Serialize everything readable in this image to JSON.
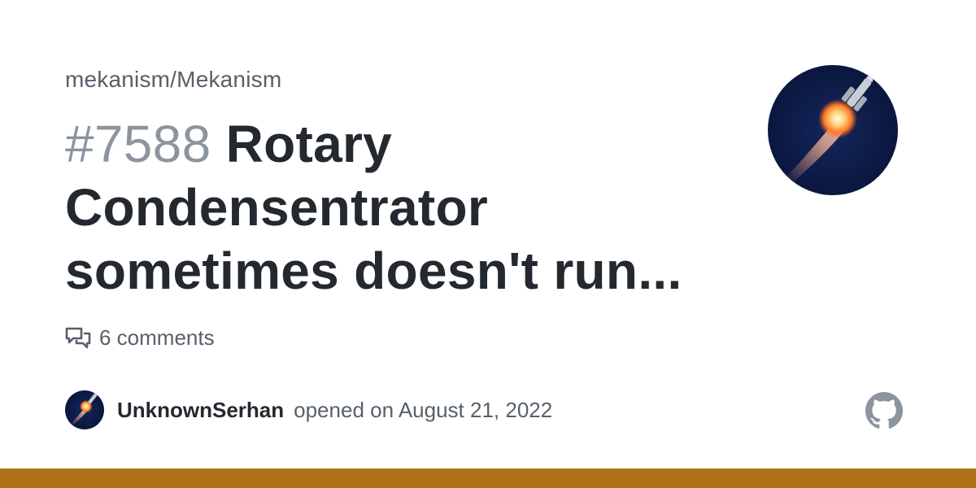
{
  "repo": {
    "full_name": "mekanism/Mekanism"
  },
  "issue": {
    "number": "#7588",
    "title": "Rotary Condensentrator sometimes doesn't run..."
  },
  "stats": {
    "comments_text": "6 comments",
    "icon": "comment-discussion-icon"
  },
  "author": {
    "username": "UnknownSerhan",
    "opened_text": "opened on August 21, 2022",
    "avatar_icon": "rocket-launch-avatar"
  },
  "brand": {
    "logo": "github-icon"
  },
  "colors": {
    "language_bar": "#b07219",
    "title": "#24292f",
    "muted": "#57606a",
    "number": "#8c959f",
    "avatar_bg": "#0b1a45"
  }
}
